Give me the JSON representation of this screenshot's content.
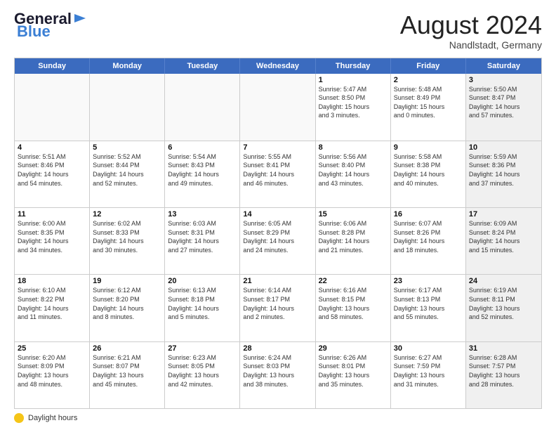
{
  "header": {
    "logo_general": "General",
    "logo_blue": "Blue",
    "month_title": "August 2024",
    "location": "Nandlstadt, Germany"
  },
  "calendar": {
    "days_of_week": [
      "Sunday",
      "Monday",
      "Tuesday",
      "Wednesday",
      "Thursday",
      "Friday",
      "Saturday"
    ],
    "weeks": [
      [
        {
          "day": "",
          "empty": true
        },
        {
          "day": "",
          "empty": true
        },
        {
          "day": "",
          "empty": true
        },
        {
          "day": "",
          "empty": true
        },
        {
          "day": "1",
          "lines": [
            "Sunrise: 5:47 AM",
            "Sunset: 8:50 PM",
            "Daylight: 15 hours",
            "and 3 minutes."
          ]
        },
        {
          "day": "2",
          "lines": [
            "Sunrise: 5:48 AM",
            "Sunset: 8:49 PM",
            "Daylight: 15 hours",
            "and 0 minutes."
          ]
        },
        {
          "day": "3",
          "lines": [
            "Sunrise: 5:50 AM",
            "Sunset: 8:47 PM",
            "Daylight: 14 hours",
            "and 57 minutes."
          ],
          "shaded": true
        }
      ],
      [
        {
          "day": "4",
          "lines": [
            "Sunrise: 5:51 AM",
            "Sunset: 8:46 PM",
            "Daylight: 14 hours",
            "and 54 minutes."
          ]
        },
        {
          "day": "5",
          "lines": [
            "Sunrise: 5:52 AM",
            "Sunset: 8:44 PM",
            "Daylight: 14 hours",
            "and 52 minutes."
          ]
        },
        {
          "day": "6",
          "lines": [
            "Sunrise: 5:54 AM",
            "Sunset: 8:43 PM",
            "Daylight: 14 hours",
            "and 49 minutes."
          ]
        },
        {
          "day": "7",
          "lines": [
            "Sunrise: 5:55 AM",
            "Sunset: 8:41 PM",
            "Daylight: 14 hours",
            "and 46 minutes."
          ]
        },
        {
          "day": "8",
          "lines": [
            "Sunrise: 5:56 AM",
            "Sunset: 8:40 PM",
            "Daylight: 14 hours",
            "and 43 minutes."
          ]
        },
        {
          "day": "9",
          "lines": [
            "Sunrise: 5:58 AM",
            "Sunset: 8:38 PM",
            "Daylight: 14 hours",
            "and 40 minutes."
          ]
        },
        {
          "day": "10",
          "lines": [
            "Sunrise: 5:59 AM",
            "Sunset: 8:36 PM",
            "Daylight: 14 hours",
            "and 37 minutes."
          ],
          "shaded": true
        }
      ],
      [
        {
          "day": "11",
          "lines": [
            "Sunrise: 6:00 AM",
            "Sunset: 8:35 PM",
            "Daylight: 14 hours",
            "and 34 minutes."
          ]
        },
        {
          "day": "12",
          "lines": [
            "Sunrise: 6:02 AM",
            "Sunset: 8:33 PM",
            "Daylight: 14 hours",
            "and 30 minutes."
          ]
        },
        {
          "day": "13",
          "lines": [
            "Sunrise: 6:03 AM",
            "Sunset: 8:31 PM",
            "Daylight: 14 hours",
            "and 27 minutes."
          ]
        },
        {
          "day": "14",
          "lines": [
            "Sunrise: 6:05 AM",
            "Sunset: 8:29 PM",
            "Daylight: 14 hours",
            "and 24 minutes."
          ]
        },
        {
          "day": "15",
          "lines": [
            "Sunrise: 6:06 AM",
            "Sunset: 8:28 PM",
            "Daylight: 14 hours",
            "and 21 minutes."
          ]
        },
        {
          "day": "16",
          "lines": [
            "Sunrise: 6:07 AM",
            "Sunset: 8:26 PM",
            "Daylight: 14 hours",
            "and 18 minutes."
          ]
        },
        {
          "day": "17",
          "lines": [
            "Sunrise: 6:09 AM",
            "Sunset: 8:24 PM",
            "Daylight: 14 hours",
            "and 15 minutes."
          ],
          "shaded": true
        }
      ],
      [
        {
          "day": "18",
          "lines": [
            "Sunrise: 6:10 AM",
            "Sunset: 8:22 PM",
            "Daylight: 14 hours",
            "and 11 minutes."
          ]
        },
        {
          "day": "19",
          "lines": [
            "Sunrise: 6:12 AM",
            "Sunset: 8:20 PM",
            "Daylight: 14 hours",
            "and 8 minutes."
          ]
        },
        {
          "day": "20",
          "lines": [
            "Sunrise: 6:13 AM",
            "Sunset: 8:18 PM",
            "Daylight: 14 hours",
            "and 5 minutes."
          ]
        },
        {
          "day": "21",
          "lines": [
            "Sunrise: 6:14 AM",
            "Sunset: 8:17 PM",
            "Daylight: 14 hours",
            "and 2 minutes."
          ]
        },
        {
          "day": "22",
          "lines": [
            "Sunrise: 6:16 AM",
            "Sunset: 8:15 PM",
            "Daylight: 13 hours",
            "and 58 minutes."
          ]
        },
        {
          "day": "23",
          "lines": [
            "Sunrise: 6:17 AM",
            "Sunset: 8:13 PM",
            "Daylight: 13 hours",
            "and 55 minutes."
          ]
        },
        {
          "day": "24",
          "lines": [
            "Sunrise: 6:19 AM",
            "Sunset: 8:11 PM",
            "Daylight: 13 hours",
            "and 52 minutes."
          ],
          "shaded": true
        }
      ],
      [
        {
          "day": "25",
          "lines": [
            "Sunrise: 6:20 AM",
            "Sunset: 8:09 PM",
            "Daylight: 13 hours",
            "and 48 minutes."
          ]
        },
        {
          "day": "26",
          "lines": [
            "Sunrise: 6:21 AM",
            "Sunset: 8:07 PM",
            "Daylight: 13 hours",
            "and 45 minutes."
          ]
        },
        {
          "day": "27",
          "lines": [
            "Sunrise: 6:23 AM",
            "Sunset: 8:05 PM",
            "Daylight: 13 hours",
            "and 42 minutes."
          ]
        },
        {
          "day": "28",
          "lines": [
            "Sunrise: 6:24 AM",
            "Sunset: 8:03 PM",
            "Daylight: 13 hours",
            "and 38 minutes."
          ]
        },
        {
          "day": "29",
          "lines": [
            "Sunrise: 6:26 AM",
            "Sunset: 8:01 PM",
            "Daylight: 13 hours",
            "and 35 minutes."
          ]
        },
        {
          "day": "30",
          "lines": [
            "Sunrise: 6:27 AM",
            "Sunset: 7:59 PM",
            "Daylight: 13 hours",
            "and 31 minutes."
          ]
        },
        {
          "day": "31",
          "lines": [
            "Sunrise: 6:28 AM",
            "Sunset: 7:57 PM",
            "Daylight: 13 hours",
            "and 28 minutes."
          ],
          "shaded": true
        }
      ]
    ]
  },
  "footer": {
    "daylight_label": "Daylight hours"
  }
}
